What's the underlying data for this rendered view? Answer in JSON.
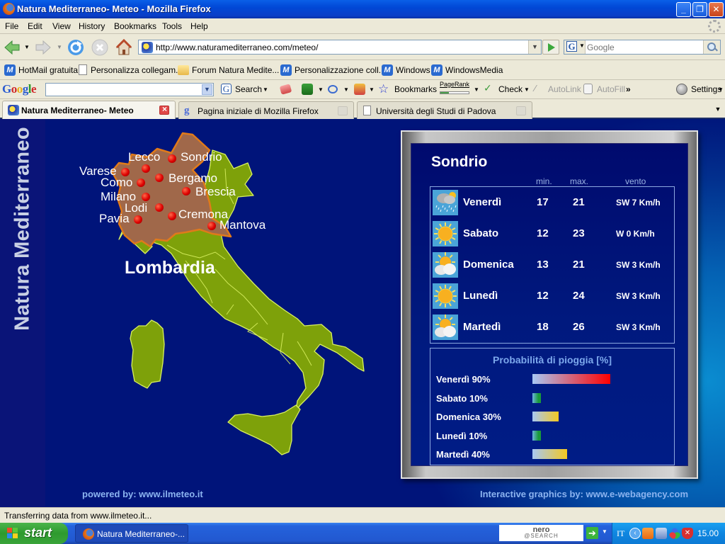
{
  "window": {
    "title": "Natura Mediterraneo- Meteo - Mozilla Firefox",
    "controls": {
      "minimize": "_",
      "restore": "❐",
      "close": "✕"
    }
  },
  "menu": {
    "items": [
      "File",
      "Edit",
      "View",
      "History",
      "Bookmarks",
      "Tools",
      "Help"
    ]
  },
  "navigation": {
    "url": "http://www.naturamediterraneo.com/meteo/",
    "search_placeholder": "Google",
    "search_engine_icon": "G"
  },
  "bookmarks": [
    {
      "label": "HotMail gratuita",
      "icon": "msn-icon"
    },
    {
      "label": "Personalizza collegam...",
      "icon": "page-icon"
    },
    {
      "label": "Forum Natura Medite...",
      "icon": "folder-star-icon"
    },
    {
      "label": "Personalizzazione coll...",
      "icon": "msn-icon"
    },
    {
      "label": "Windows",
      "icon": "msn-icon"
    },
    {
      "label": "WindowsMedia",
      "icon": "msn-icon"
    }
  ],
  "google_toolbar": {
    "logo": "Google",
    "search_label": "Search",
    "bookmarks_label": "Bookmarks",
    "pagerank_label": "PageRank",
    "pagerank_fraction": 0.3,
    "check_label": "Check",
    "autolink_label": "AutoLink",
    "autofill_label": "AutoFill",
    "more_label": "»",
    "settings_label": "Settings"
  },
  "tabs": [
    {
      "label": "Natura Mediterraneo- Meteo",
      "active": true
    },
    {
      "label": "Pagina iniziale di Mozilla Firefox",
      "active": false
    },
    {
      "label": "Università degli Studi di Padova",
      "active": false
    }
  ],
  "page": {
    "side_title": "Natura Mediterraneo",
    "region": "Lombardia",
    "cities": [
      "Lecco",
      "Sondrio",
      "Varese",
      "Como",
      "Bergamo",
      "Milano",
      "Brescia",
      "Lodi",
      "Cremona",
      "Pavia",
      "Mantova"
    ],
    "powered_by": "powered by: www.ilmeteo.it",
    "credits": "Interactive graphics by: www.e-webagency.com",
    "colors": {
      "land": "#7ea10a",
      "region": "#a0684a",
      "city_dot": "#dd0000"
    },
    "forecast": {
      "city": "Sondrio",
      "headers": {
        "min": "min.",
        "max": "max.",
        "wind": "vento"
      },
      "days": [
        {
          "day": "Venerdì",
          "icon": "rain-cloud-icon",
          "min": "17",
          "max": "21",
          "wind": "SW  7 Km/h"
        },
        {
          "day": "Sabato",
          "icon": "sun-icon",
          "min": "12",
          "max": "23",
          "wind": "W  0 Km/h"
        },
        {
          "day": "Domenica",
          "icon": "partly-cloudy-icon",
          "min": "13",
          "max": "21",
          "wind": "SW  3 Km/h"
        },
        {
          "day": "Lunedì",
          "icon": "sun-icon",
          "min": "12",
          "max": "24",
          "wind": "SW  3 Km/h"
        },
        {
          "day": "Martedì",
          "icon": "partly-cloudy-icon",
          "min": "18",
          "max": "26",
          "wind": "SW  3 Km/h"
        }
      ]
    },
    "rain": {
      "title": "Probabilità di pioggia [%]",
      "rows": [
        {
          "label": "Venerdì 90%",
          "percent": 90,
          "color": "#ff0000"
        },
        {
          "label": "Sabato 10%",
          "percent": 10,
          "color": "#1a9a3a"
        },
        {
          "label": "Domenica 30%",
          "percent": 30,
          "color": "#f4c820"
        },
        {
          "label": "Lunedì 10%",
          "percent": 10,
          "color": "#1a9a3a"
        },
        {
          "label": "Martedì 40%",
          "percent": 40,
          "color": "#f4c820"
        }
      ]
    }
  },
  "status": {
    "text": "Transferring data from www.ilmeteo.it..."
  },
  "taskbar": {
    "start_label": "start",
    "task_label": "Natura Mediterraneo-...",
    "nero_top": "nero",
    "nero_bottom": "@SEARCH",
    "language": "IT",
    "clock": "15.00"
  }
}
